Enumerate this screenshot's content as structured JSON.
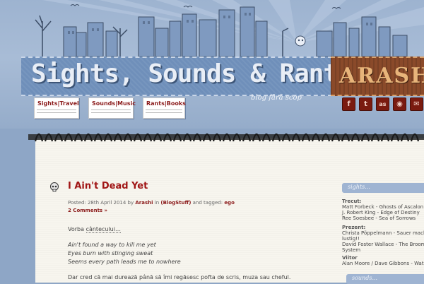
{
  "header": {
    "title": "Sights, Sounds & Rants",
    "tag": "ARASHI",
    "subtitle": "blog fără scop"
  },
  "nav": [
    {
      "label": "Sights|Travel"
    },
    {
      "label": "Sounds|Music"
    },
    {
      "label": "Rants|Books"
    }
  ],
  "social_icons": [
    "facebook-icon",
    "tumblr-icon",
    "lastfm-icon",
    "rss-icon",
    "mail-icon"
  ],
  "post": {
    "title": "I Ain't Dead Yet",
    "meta_posted": "Posted: 28th April 2014 by",
    "author": "Arashi",
    "meta_in": "in",
    "category": "(BlogStuff)",
    "meta_tagged": "and tagged:",
    "tag": "ego",
    "comments": "2 Comments »",
    "intro_prefix": "Vorba",
    "intro_link": "cântecului…",
    "lyrics": [
      "Ain't found a way to kill me yet",
      "Eyes burn with stinging sweat",
      "Seems every path leads me to nowhere"
    ],
    "paragraph": "Dar cred că mai durează până să îmi regăsesc pofta de scris, muza sau cheful."
  },
  "sidebar": {
    "sights_tab": "sights...",
    "sounds_tab": "sounds...",
    "sections": [
      {
        "heading": "Trecut:",
        "lines": [
          "Matt Forbeck - Ghosts of Ascalon",
          "J. Robert King - Edge of Destiny",
          "Ree Soesbee - Sea of Sorrows"
        ]
      },
      {
        "heading": "Prezent:",
        "lines": [
          "Christa Pöppelmann - Sauer macht",
          "lustig!!",
          "David Foster Wallace - The Broom of",
          "System"
        ]
      },
      {
        "heading": "Viitor",
        "lines": [
          "Alan Moore / Dave Gibbons - Watchm"
        ]
      }
    ]
  }
}
